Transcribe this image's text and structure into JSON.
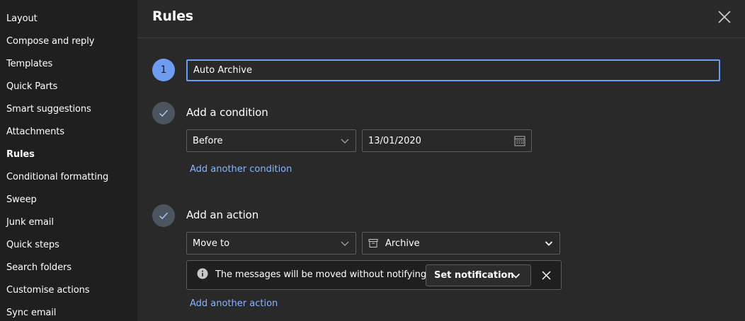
{
  "sidebar": {
    "items": [
      {
        "label": "Layout"
      },
      {
        "label": "Compose and reply"
      },
      {
        "label": "Templates"
      },
      {
        "label": "Quick Parts"
      },
      {
        "label": "Smart suggestions"
      },
      {
        "label": "Attachments"
      },
      {
        "label": "Rules",
        "active": true
      },
      {
        "label": "Conditional formatting"
      },
      {
        "label": "Sweep"
      },
      {
        "label": "Junk email"
      },
      {
        "label": "Quick steps"
      },
      {
        "label": "Search folders"
      },
      {
        "label": "Customise actions"
      },
      {
        "label": "Sync email"
      }
    ]
  },
  "header": {
    "title": "Rules",
    "close_icon": "close-icon"
  },
  "rule": {
    "step_number": "1",
    "name_value": "Auto Archive",
    "condition": {
      "title": "Add a condition",
      "type": "Before",
      "date": "13/01/2020",
      "add_link": "Add another condition"
    },
    "action": {
      "title": "Add an action",
      "type": "Move to",
      "folder": "Archive",
      "info_text": "The messages will be moved without notifying.",
      "set_notification": "Set notification",
      "add_link": "Add another action"
    }
  },
  "colors": {
    "accent": "#6e9cf0",
    "link": "#8ab4ff",
    "sidebar_bg": "#1f1f1f",
    "panel_bg": "#292929"
  }
}
